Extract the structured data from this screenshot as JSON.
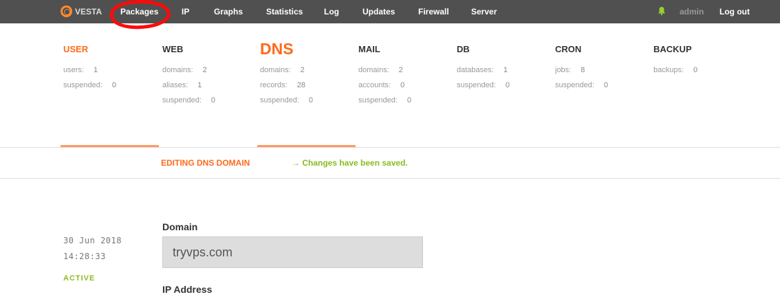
{
  "nav": {
    "logo": "VESTA",
    "items": [
      "Packages",
      "IP",
      "Graphs",
      "Statistics",
      "Log",
      "Updates",
      "Firewall",
      "Server"
    ],
    "user": "admin",
    "logout": "Log out"
  },
  "stats": [
    {
      "title": "USER",
      "rows": [
        {
          "label": "users:",
          "value": "1"
        },
        {
          "label": "suspended:",
          "value": "0"
        }
      ]
    },
    {
      "title": "WEB",
      "rows": [
        {
          "label": "domains:",
          "value": "2"
        },
        {
          "label": "aliases:",
          "value": "1"
        },
        {
          "label": "suspended:",
          "value": "0"
        }
      ]
    },
    {
      "title": "DNS",
      "rows": [
        {
          "label": "domains:",
          "value": "2"
        },
        {
          "label": "records:",
          "value": "28"
        },
        {
          "label": "suspended:",
          "value": "0"
        }
      ]
    },
    {
      "title": "MAIL",
      "rows": [
        {
          "label": "domains:",
          "value": "2"
        },
        {
          "label": "accounts:",
          "value": "0"
        },
        {
          "label": "suspended:",
          "value": "0"
        }
      ]
    },
    {
      "title": "DB",
      "rows": [
        {
          "label": "databases:",
          "value": "1"
        },
        {
          "label": "suspended:",
          "value": "0"
        }
      ]
    },
    {
      "title": "CRON",
      "rows": [
        {
          "label": "jobs:",
          "value": "8"
        },
        {
          "label": "suspended:",
          "value": "0"
        }
      ]
    },
    {
      "title": "BACKUP",
      "rows": [
        {
          "label": "backups:",
          "value": "0"
        }
      ]
    }
  ],
  "edit": {
    "title": "EDITING DNS DOMAIN",
    "saved": "→ Changes have been saved."
  },
  "meta": {
    "date": "30 Jun 2018",
    "time": "14:28:33",
    "status": "ACTIVE"
  },
  "form": {
    "domain_label": "Domain",
    "domain_value": "tryvps.com",
    "ip_label": "IP Address"
  },
  "colors": {
    "accent": "#ff6a1a",
    "success": "#8bbb20",
    "nav_bg": "#505050"
  }
}
